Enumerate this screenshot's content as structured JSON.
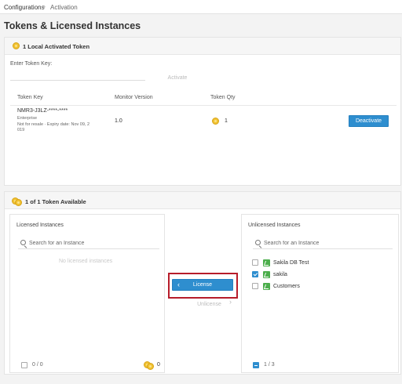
{
  "breadcrumb": {
    "root": "Configurations",
    "separator": "›",
    "current": "Activation"
  },
  "page_title": "Tokens & Licensed Instances",
  "local_tokens": {
    "header": "1 Local Activated Token",
    "enter_label": "Enter Token Key:",
    "input_value": "",
    "activate_label": "Activate",
    "columns": [
      "Token Key",
      "Monitor Version",
      "Token Qty"
    ],
    "row": {
      "token_key": "NMR3-J3LZ-****-****",
      "edition": "Enterprise",
      "terms": "Not for resale · Expiry date: Nov 09, 2",
      "terms_cont": "019",
      "monitor_version": "1.0",
      "token_qty": "1",
      "deactivate_label": "Deactivate"
    }
  },
  "available": {
    "header": "1 of 1 Token Available",
    "licensed": {
      "title": "Licensed Instances",
      "search_placeholder": "Search for an Instance",
      "empty_text": "No licensed instances",
      "count": "0 / 0",
      "token_count": "0"
    },
    "license_button": "License",
    "unlicense_button": "Unlicense",
    "unlicensed": {
      "title": "Unlicensed Instances",
      "search_placeholder": "Search for an Instance",
      "items": [
        {
          "name": "Sakila DB Test",
          "checked": false
        },
        {
          "name": "sakila",
          "checked": true
        },
        {
          "name": "Customers",
          "checked": false
        }
      ],
      "count": "1 / 3"
    }
  },
  "colors": {
    "accent": "#2e8ecf",
    "coin": "#f1c232",
    "highlight": "#b71c2a",
    "instance_icon": "#4cae4c"
  }
}
